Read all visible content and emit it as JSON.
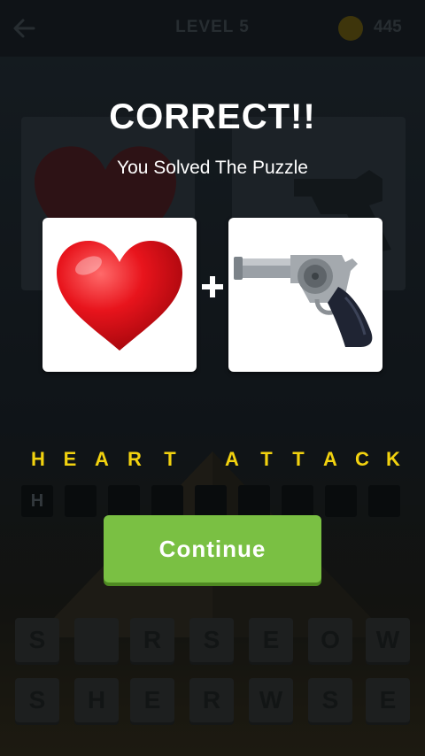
{
  "header": {
    "level_title": "LEVEL 5",
    "coins": "445"
  },
  "overlay": {
    "title": "CORRECT!!",
    "subtitle": "You Solved The Puzzle",
    "clues": [
      {
        "icon": "heart-emoji"
      },
      {
        "icon": "revolver-emoji"
      }
    ],
    "operator": "+",
    "answer_letters": [
      "H",
      "E",
      "A",
      "R",
      "T",
      " ",
      "A",
      "T",
      "T",
      "A",
      "C",
      "K"
    ],
    "continue_label": "Continue"
  },
  "answer_slots": [
    "H",
    "",
    "",
    "",
    "",
    "",
    "",
    "",
    ""
  ],
  "keyboard": {
    "row1": [
      "S",
      "",
      "R",
      "S",
      "E",
      "O",
      "W"
    ],
    "row2": [
      "S",
      "H",
      "E",
      "R",
      "W",
      "S",
      "E"
    ]
  },
  "colors": {
    "answer_letter": "#f2d20f",
    "continue_button": "#7ac043",
    "heart": "#e0141a"
  }
}
